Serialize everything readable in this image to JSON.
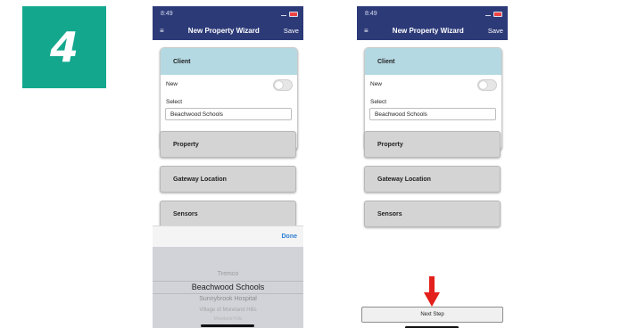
{
  "step_number": "4",
  "colors": {
    "accent": "#13a88e",
    "navbar": "#2c3a78",
    "client_header": "#b5d9e3",
    "arrow": "#e3201b",
    "done": "#2e7ed6"
  },
  "phone_left": {
    "status_time": "8:49",
    "menu_icon": "≡",
    "nav_title": "New Property Wizard",
    "save_label": "Save",
    "client_title": "Client",
    "new_label": "New",
    "select_label": "Select",
    "select_value": "Beachwood Schools",
    "property_label": "Property",
    "gateway_label": "Gateway Location",
    "sensors_label": "Sensors",
    "done_label": "Done",
    "picker_options": [
      "Tremco",
      "Beachwood Schools",
      "Sunnybrook Hospital",
      "Village of Moreland Hills",
      "Moreland Hills"
    ],
    "picker_selected": "Beachwood Schools"
  },
  "phone_right": {
    "status_time": "8:49",
    "menu_icon": "≡",
    "nav_title": "New Property Wizard",
    "save_label": "Save",
    "client_title": "Client",
    "new_label": "New",
    "select_label": "Select",
    "select_value": "Beachwood Schools",
    "property_label": "Property",
    "gateway_label": "Gateway Location",
    "sensors_label": "Sensors",
    "next_step_label": "Next Step"
  }
}
